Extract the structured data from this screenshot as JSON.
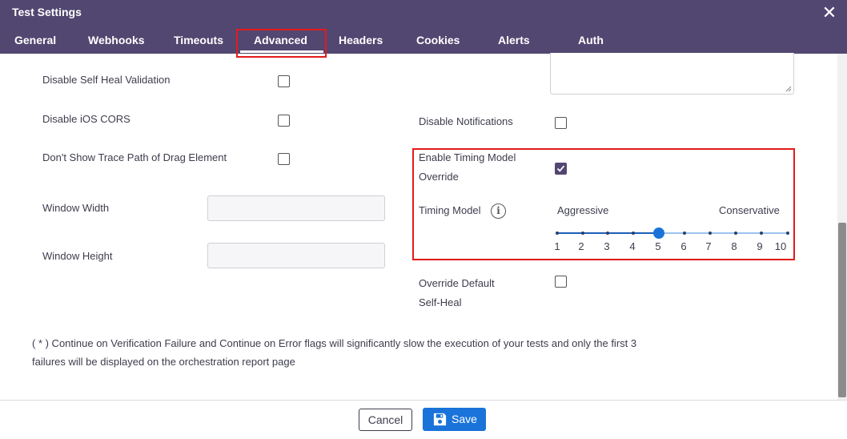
{
  "dialog": {
    "title": "Test Settings",
    "close_symbol": "✕"
  },
  "tabs": [
    {
      "label": "General"
    },
    {
      "label": "Webhooks"
    },
    {
      "label": "Timeouts"
    },
    {
      "label": "Advanced"
    },
    {
      "label": "Headers"
    },
    {
      "label": "Cookies"
    },
    {
      "label": "Alerts"
    },
    {
      "label": "Auth"
    }
  ],
  "active_tab": "Advanced",
  "left_settings": {
    "disable_self_heal_validation": {
      "label": "Disable Self Heal Validation",
      "checked": false
    },
    "disable_ios_cors": {
      "label": "Disable iOS CORS",
      "checked": false
    },
    "dont_show_trace_path": {
      "label": "Don't Show Trace Path of Drag Element",
      "checked": false
    },
    "window_width": {
      "label": "Window Width",
      "value": ""
    },
    "window_height": {
      "label": "Window Height",
      "value": ""
    }
  },
  "right_settings": {
    "disable_notifications": {
      "label": "Disable Notifications",
      "checked": false
    },
    "enable_timing_model_override": {
      "label_line1": "Enable Timing Model",
      "label_line2": "Override",
      "checked": true
    },
    "timing_model": {
      "label": "Timing Model",
      "info_symbol": "i",
      "min_label": "Aggressive",
      "max_label": "Conservative",
      "ticks": [
        "1",
        "2",
        "3",
        "4",
        "5",
        "6",
        "7",
        "8",
        "9",
        "10"
      ],
      "value": 5
    },
    "override_default_self_heal": {
      "label_line1": "Override Default",
      "label_line2": "Self-Heal",
      "checked": false
    }
  },
  "note": {
    "line1": "( * ) Continue on Verification Failure and Continue on Error flags will significantly slow the execution of your tests and only the first 3",
    "line2": "failures will be displayed on the orchestration report page"
  },
  "footer": {
    "cancel_label": "Cancel",
    "save_label": "Save"
  },
  "colors": {
    "header": "#524771",
    "accent": "#1a73d9",
    "highlight": "#e21b1b"
  }
}
